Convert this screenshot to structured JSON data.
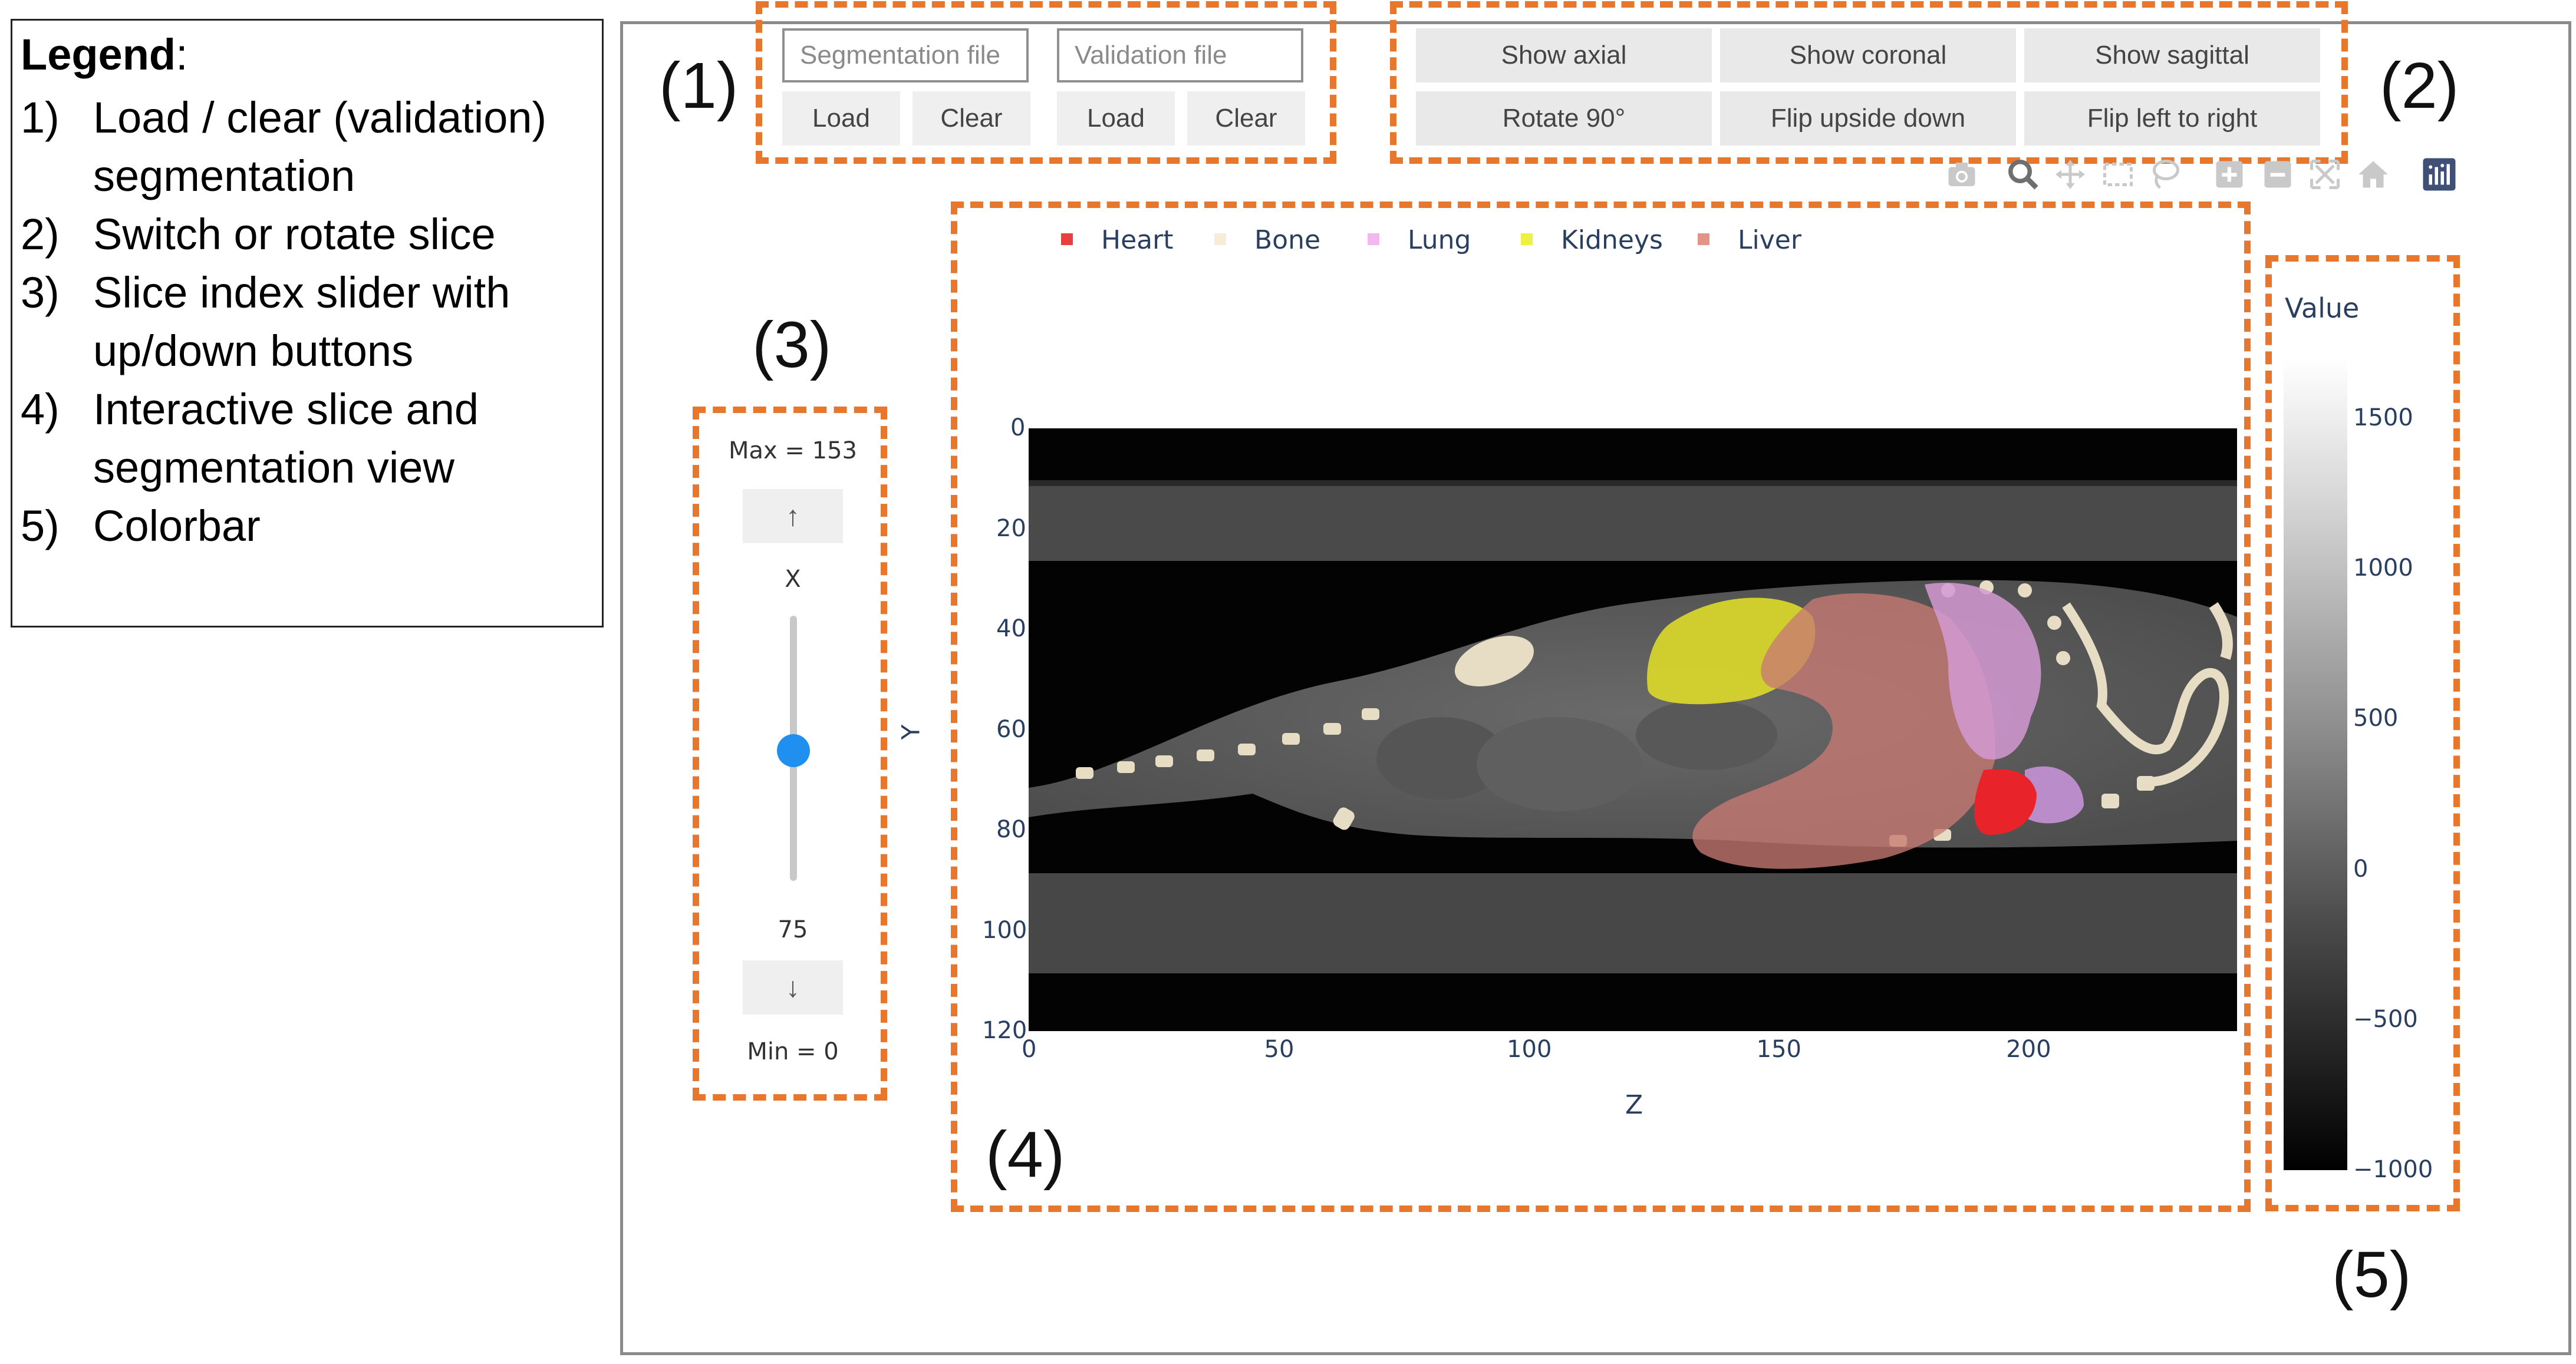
{
  "legend": {
    "title": "Legend",
    "items": [
      {
        "num": "1)",
        "lines": [
          "Load / clear (validation)",
          "segmentation"
        ]
      },
      {
        "num": "2)",
        "lines": [
          "Switch or rotate slice"
        ]
      },
      {
        "num": "3)",
        "lines": [
          "Slice index slider with",
          "up/down buttons"
        ]
      },
      {
        "num": "4)",
        "lines": [
          "Interactive slice and",
          "segmentation view"
        ]
      },
      {
        "num": "5)",
        "lines": [
          "Colorbar"
        ]
      }
    ]
  },
  "callouts": {
    "c1": "(1)",
    "c2": "(2)",
    "c3": "(3)",
    "c4": "(4)",
    "c5": "(5)"
  },
  "file_controls": {
    "segmentation_placeholder": "Segmentation file",
    "validation_placeholder": "Validation file",
    "load_label": "Load",
    "clear_label": "Clear"
  },
  "view_controls": {
    "show_axial": "Show axial",
    "show_coronal": "Show coronal",
    "show_sagittal": "Show sagittal",
    "rotate": "Rotate 90°",
    "flip_ud": "Flip upside down",
    "flip_lr": "Flip left to right"
  },
  "modebar": {
    "icons": [
      "camera-icon",
      "zoom-icon",
      "pan-icon",
      "box-select-icon",
      "lasso-select-icon",
      "zoom-in-icon",
      "zoom-out-icon",
      "autoscale-icon",
      "reset-axes-icon",
      "plotly-logo-icon"
    ]
  },
  "slider": {
    "max_label": "Max = 153",
    "min_label": "Min = 0",
    "axis_label": "X",
    "value": "75",
    "value_num": 75,
    "min": 0,
    "max": 153,
    "up_symbol": "↑",
    "down_symbol": "↓",
    "accent": "#1f8ff0"
  },
  "plot": {
    "xlabel": "Z",
    "ylabel": "Y",
    "x_ticks": [
      "0",
      "50",
      "100",
      "150",
      "200"
    ],
    "y_ticks": [
      "0",
      "20",
      "40",
      "60",
      "80",
      "100",
      "120"
    ],
    "xlim": [
      0,
      242
    ],
    "ylim": [
      0,
      120
    ],
    "segments": [
      {
        "name": "Heart",
        "color": "#e8403f"
      },
      {
        "name": "Bone",
        "color": "#f6ecd9"
      },
      {
        "name": "Lung",
        "color": "#f4b6f0"
      },
      {
        "name": "Kidneys",
        "color": "#f0f040"
      },
      {
        "name": "Liver",
        "color": "#e0948a"
      }
    ]
  },
  "colorbar": {
    "title": "Value",
    "ticks": [
      "1500",
      "1000",
      "500",
      "0",
      "−500",
      "−1000"
    ],
    "range": [
      -1000,
      1700
    ]
  },
  "colors": {
    "dashed": "#e8772e",
    "text": "#2a3f5f"
  }
}
